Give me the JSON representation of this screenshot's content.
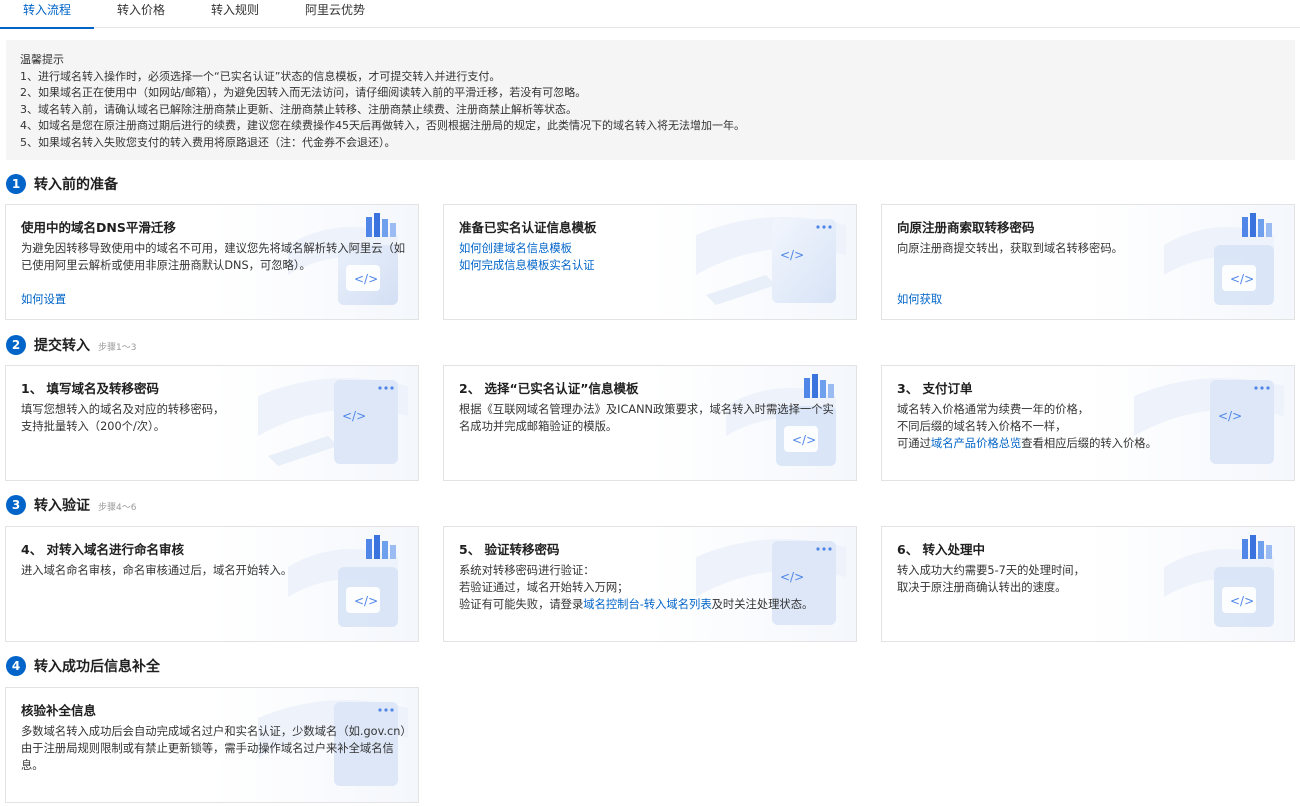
{
  "tabs": [
    {
      "label": "转入流程",
      "active": true
    },
    {
      "label": "转入价格",
      "active": false
    },
    {
      "label": "转入规则",
      "active": false
    },
    {
      "label": "阿里云优势",
      "active": false
    }
  ],
  "tips": {
    "title": "温馨提示",
    "lines": [
      "1、进行域名转入操作时，必须选择一个“已实名认证”状态的信息模板，才可提交转入并进行支付。",
      "2、如果域名正在使用中（如网站/邮箱），为避免因转入而无法访问，请仔细阅读转入前的平滑迁移，若没有可忽略。",
      "3、域名转入前，请确认域名已解除注册商禁止更新、注册商禁止转移、注册商禁止续费、注册商禁止解析等状态。",
      "4、如域名是您在原注册商过期后进行的续费，建议您在续费操作45天后再做转入，否则根据注册局的规定，此类情况下的域名转入将无法增加一年。",
      "5、如果域名转入失败您支付的转入费用将原路退还（注：代金券不会退还）。"
    ]
  },
  "sections": [
    {
      "num": "1",
      "title": "转入前的准备",
      "step": ""
    },
    {
      "num": "2",
      "title": "提交转入",
      "step": "步骤1～3"
    },
    {
      "num": "3",
      "title": "转入验证",
      "step": "步骤4～6"
    },
    {
      "num": "4",
      "title": "转入成功后信息补全",
      "step": ""
    }
  ],
  "cards": {
    "s1c1": {
      "title": "使用中的域名DNS平滑迁移",
      "body": "为避免因转移导致使用中的域名不可用，建议您先将域名解析转入阿里云（如已使用阿里云解析或使用非原注册商默认DNS，可忽略）。",
      "link": "如何设置"
    },
    "s1c2": {
      "title": "准备已实名认证信息模板",
      "link1": "如何创建域名信息模板",
      "link2": "如何完成信息模板实名认证"
    },
    "s1c3": {
      "title": "向原注册商索取转移密码",
      "body": "向原注册商提交转出，获取到域名转移密码。",
      "link": "如何获取"
    },
    "s2c1": {
      "title": "1、 填写域名及转移密码",
      "line1": "填写您想转入的域名及对应的转移密码，",
      "line2": "支持批量转入（200个/次）。"
    },
    "s2c2": {
      "title": "2、 选择“已实名认证”信息模板",
      "body": "根据《互联网域名管理办法》及ICANN政策要求，域名转入时需选择一个实名成功并完成邮箱验证的模版。"
    },
    "s2c3": {
      "title": "3、 支付订单",
      "line1": "域名转入价格通常为续费一年的价格，",
      "line2": "不同后缀的域名转入价格不一样，",
      "line3_pre": "可通过",
      "line3_link": "域名产品价格总览",
      "line3_post": "查看相应后缀的转入价格。"
    },
    "s3c1": {
      "title": "4、 对转入域名进行命名审核",
      "body": "进入域名命名审核，命名审核通过后，域名开始转入。"
    },
    "s3c2": {
      "title": "5、 验证转移密码",
      "line1": "系统对转移密码进行验证：",
      "line2": "若验证通过，域名开始转入万网；",
      "line3_pre": "验证有可能失败，请登录",
      "line3_link": "域名控制台-转入域名列表",
      "line3_post": "及时关注处理状态。"
    },
    "s3c3": {
      "title": "6、 转入处理中",
      "line1": "转入成功大约需要5-7天的处理时间，",
      "line2": "取决于原注册商确认转出的速度。"
    },
    "s4c1": {
      "title": "核验补全信息",
      "body": "多数域名转入成功后会自动完成域名过户和实名认证，少数域名（如.gov.cn）由于注册局规则限制或有禁止更新锁等，需手动操作域名过户来补全域名信息。"
    }
  },
  "colors": {
    "accent": "#0064c8",
    "tips_bg": "#f5f5f6",
    "border": "#e3e3e3"
  },
  "icons": {
    "illustration": "server-stack-illustration",
    "illustration_alt": "browser-window-illustration"
  }
}
